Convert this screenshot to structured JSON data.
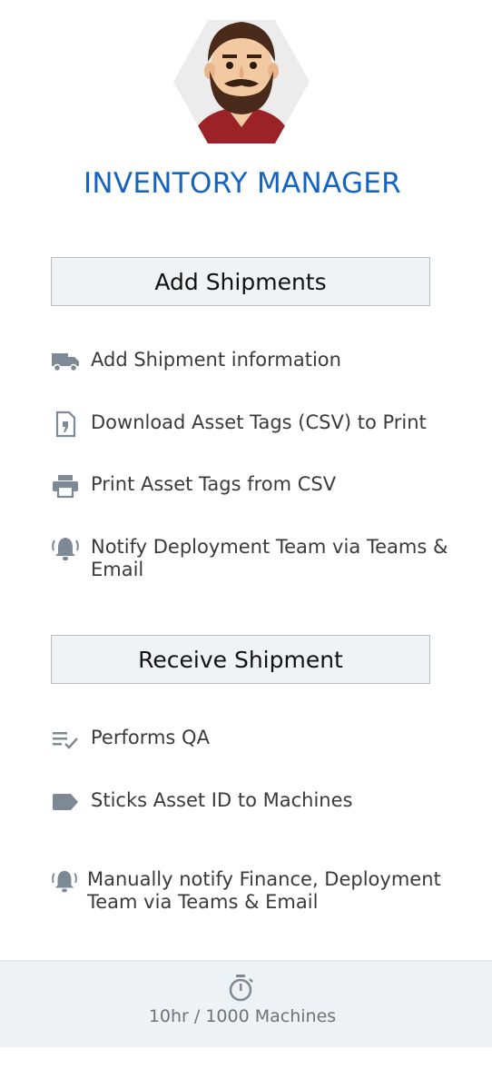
{
  "role": {
    "title": "INVENTORY MANAGER"
  },
  "sections": [
    {
      "button_label": "Add Shipments",
      "items": [
        {
          "icon": "truck-icon",
          "label": "Add Shipment information"
        },
        {
          "icon": "csv-file-icon",
          "label": "Download Asset Tags (CSV) to Print"
        },
        {
          "icon": "printer-icon",
          "label": "Print Asset Tags from CSV"
        },
        {
          "icon": "bell-icon",
          "label": "Notify Deployment Team via Teams &",
          "label2": "Email"
        }
      ]
    },
    {
      "button_label": "Receive Shipment",
      "items": [
        {
          "icon": "checklist-icon",
          "label": "Performs QA"
        },
        {
          "icon": "tag-icon",
          "label": "Sticks Asset ID to Machines"
        },
        {
          "icon": "bell-icon",
          "label": "Manually notify Finance, Deployment",
          "label2": "Team via Teams & Email"
        }
      ]
    }
  ],
  "footer": {
    "icon": "stopwatch-icon",
    "text": "10hr / 1000 Machines"
  },
  "colors": {
    "title": "#1565c0",
    "icon": "#7d8a96",
    "button_bg": "#f0f3f6"
  }
}
